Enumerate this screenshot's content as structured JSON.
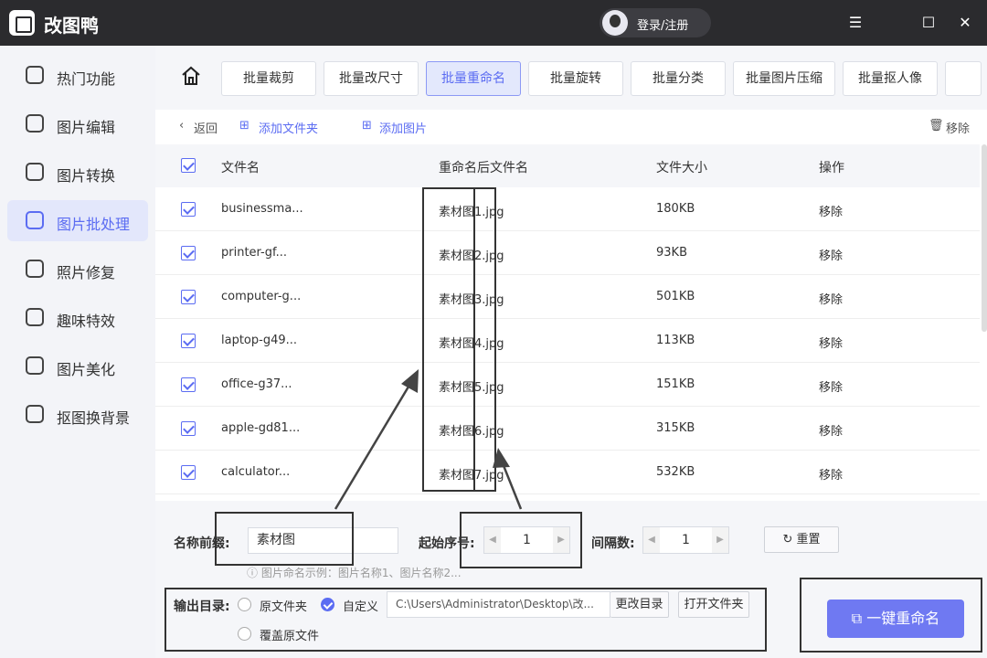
{
  "app": {
    "name": "改图鸭",
    "login": "登录/注册"
  },
  "window": {
    "minimize": "☰",
    "maximize": "☐",
    "close": "✕"
  },
  "sidebar": {
    "items": [
      {
        "label": "热门功能"
      },
      {
        "label": "图片编辑"
      },
      {
        "label": "图片转换"
      },
      {
        "label": "图片批处理"
      },
      {
        "label": "照片修复"
      },
      {
        "label": "趣味特效"
      },
      {
        "label": "图片美化"
      },
      {
        "label": "抠图换背景"
      }
    ]
  },
  "toolbar": {
    "tabs": [
      "批量裁剪",
      "批量改尺寸",
      "批量重命名",
      "批量旋转",
      "批量分类",
      "批量图片压缩",
      "批量抠人像"
    ]
  },
  "actions": {
    "back": "返回",
    "add_folder": "添加文件夹",
    "add_image": "添加图片",
    "remove": "移除"
  },
  "table": {
    "headers": [
      "文件名",
      "重命名后文件名",
      "文件大小",
      "操作"
    ],
    "rows": [
      {
        "name": "businessma...",
        "renamed": "素材图1.jpg",
        "size": "180KB",
        "op": "移除"
      },
      {
        "name": "printer-gf...",
        "renamed": "素材图2.jpg",
        "size": "93KB",
        "op": "移除"
      },
      {
        "name": "computer-g...",
        "renamed": "素材图3.jpg",
        "size": "501KB",
        "op": "移除"
      },
      {
        "name": "laptop-g49...",
        "renamed": "素材图4.jpg",
        "size": "113KB",
        "op": "移除"
      },
      {
        "name": "office-g37...",
        "renamed": "素材图5.jpg",
        "size": "151KB",
        "op": "移除"
      },
      {
        "name": "apple-gd81...",
        "renamed": "素材图6.jpg",
        "size": "315KB",
        "op": "移除"
      },
      {
        "name": "calculator...",
        "renamed": "素材图7.jpg",
        "size": "532KB",
        "op": "移除"
      }
    ]
  },
  "settings": {
    "prefix_label": "名称前缀:",
    "prefix_value": "素材图",
    "start_label": "起始序号:",
    "start_value": "1",
    "interval_label": "间隔数:",
    "interval_value": "1",
    "reset": "重置",
    "hint": "ⓘ 图片命名示例：图片名称1、图片名称2...",
    "output_label": "输出目录:",
    "opt_original": "原文件夹",
    "opt_custom": "自定义",
    "path": "C:\\Users\\Administrator\\Desktop\\改...",
    "change_dir": "更改目录",
    "open_folder": "打开文件夹",
    "overwrite": "覆盖原文件",
    "rename_all": "一键重命名"
  }
}
